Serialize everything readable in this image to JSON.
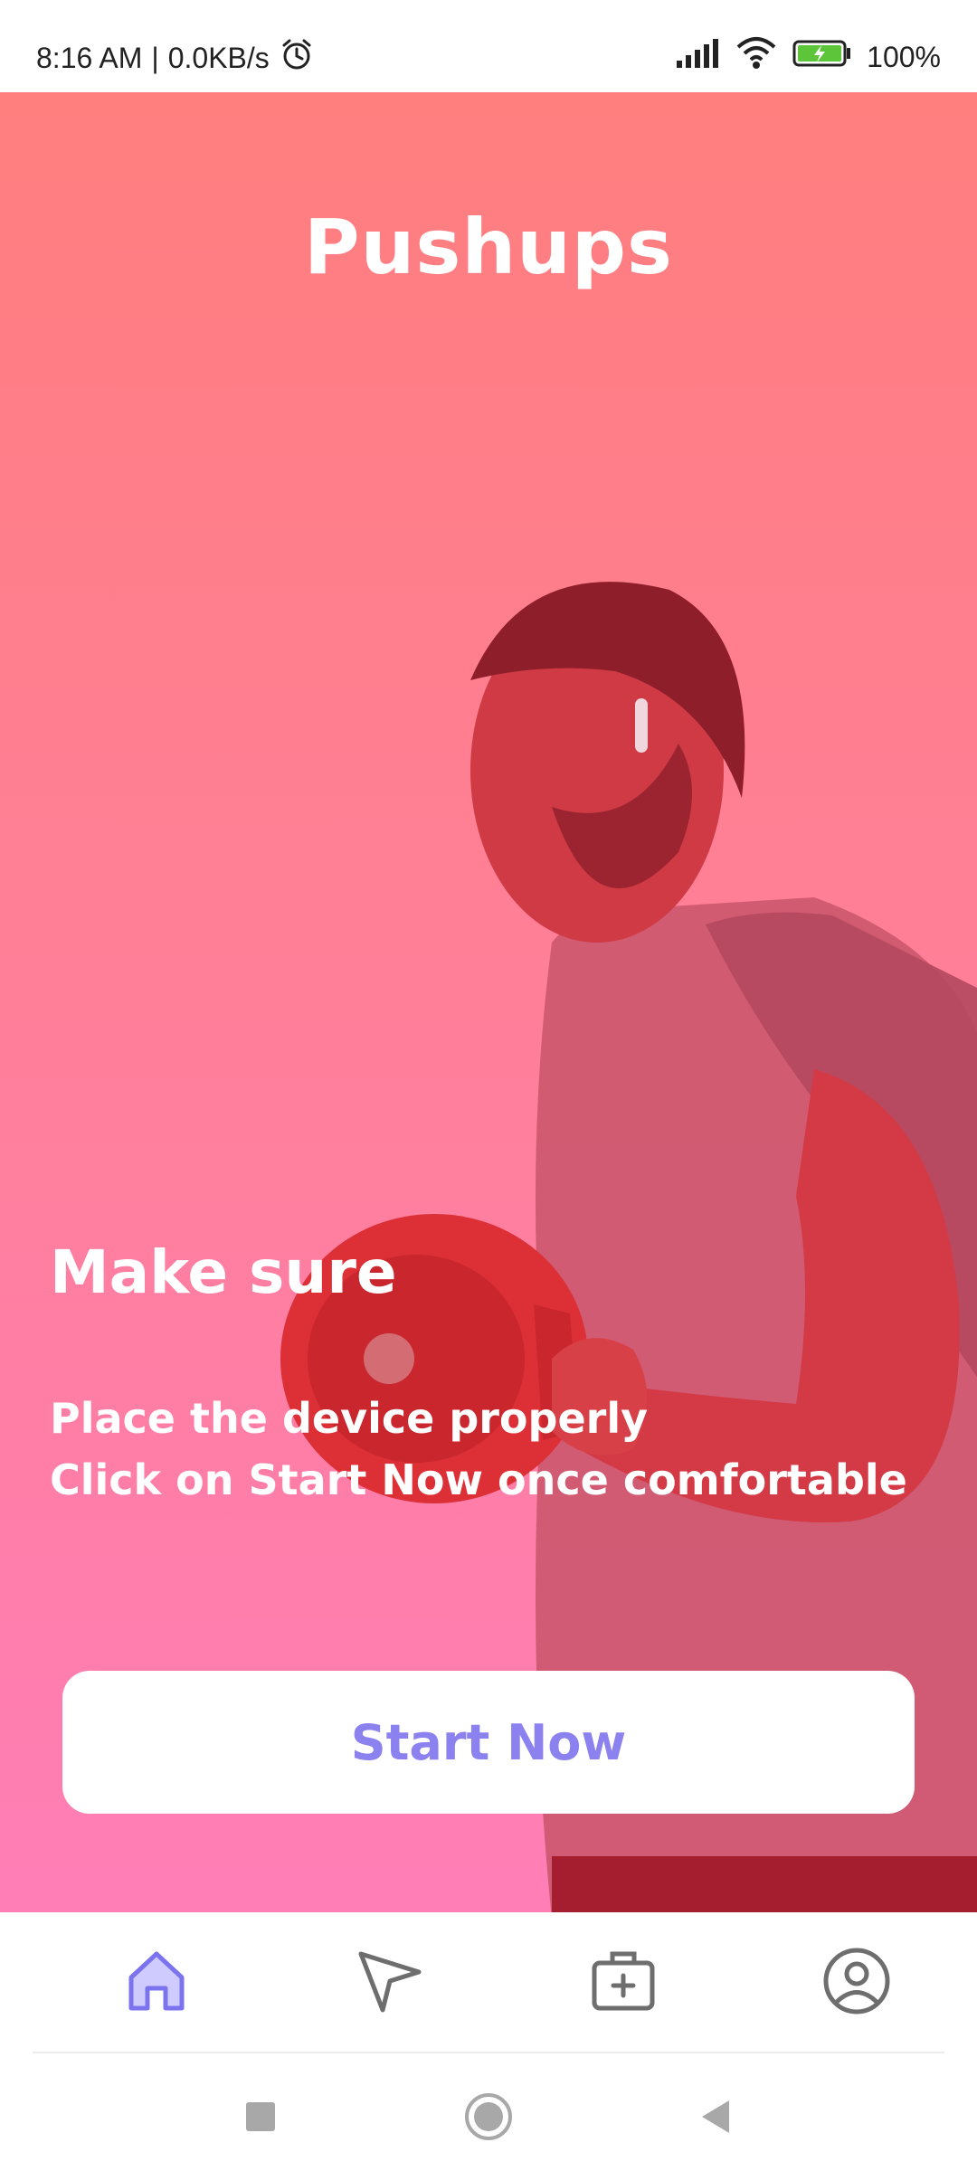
{
  "status_bar": {
    "time": "8:16 AM",
    "separator": "|",
    "network_speed": "0.0KB/s",
    "battery": "100%",
    "icons": [
      "alarm-icon",
      "signal-icon",
      "wifi-icon",
      "battery-charging-icon"
    ]
  },
  "screen": {
    "title": "Pushups",
    "heading": "Make sure",
    "instruction_line1": "Place the device properly",
    "instruction_line2": "Click on Start Now once comfortable",
    "start_button": "Start Now"
  },
  "tabbar": {
    "tabs": [
      {
        "name": "home",
        "icon": "home-icon",
        "active": true
      },
      {
        "name": "navigate",
        "icon": "send-icon",
        "active": false
      },
      {
        "name": "health",
        "icon": "medical-kit-icon",
        "active": false
      },
      {
        "name": "profile",
        "icon": "profile-icon",
        "active": false
      }
    ]
  },
  "system_nav": {
    "buttons": [
      "recents-icon",
      "home-circle-icon",
      "back-icon"
    ]
  },
  "colors": {
    "accent": "#8b82f0",
    "gradient_top": "#ff7e7e",
    "gradient_bottom": "#ff7eb6",
    "active_tab": "#7b74ee",
    "inactive_tab": "#6e6e6e"
  }
}
